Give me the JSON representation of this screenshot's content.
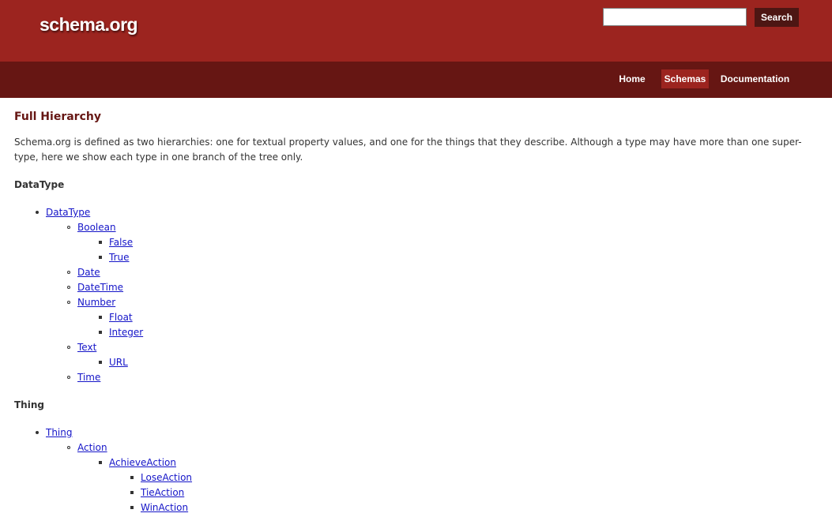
{
  "header": {
    "logo": "schema.org",
    "search": {
      "value": "",
      "button_label": "Search"
    }
  },
  "nav": {
    "items": [
      {
        "label": "Home"
      },
      {
        "label": "Schemas"
      },
      {
        "label": "Documentation"
      }
    ],
    "selected": "Schemas"
  },
  "page": {
    "title": "Full Hierarchy",
    "intro": "Schema.org is defined as two hierarchies: one for textual property values, and one for the things that they describe. Although a type may have more than one super-type, here we show each type in one branch of the tree only."
  },
  "datatype_section": {
    "heading": "DataType",
    "root": "DataType",
    "boolean": {
      "label": "Boolean",
      "children": [
        "False",
        "True"
      ]
    },
    "date": "Date",
    "datetime": "DateTime",
    "number": {
      "label": "Number",
      "children": [
        "Float",
        "Integer"
      ]
    },
    "text": {
      "label": "Text",
      "children": [
        "URL"
      ]
    },
    "time": "Time"
  },
  "thing_section": {
    "heading": "Thing",
    "root": "Thing",
    "action": "Action",
    "achieve_action": {
      "label": "AchieveAction",
      "children": [
        "LoseAction",
        "TieAction",
        "WinAction"
      ]
    }
  },
  "colors": {
    "header_bg": "#9c241f",
    "nav_bg": "#661613",
    "nav_selected_bg": "#9c241f",
    "search_button_bg": "#4d1613",
    "title_color": "#661613",
    "link_color": "#1515c8",
    "text_color": "#333333"
  }
}
